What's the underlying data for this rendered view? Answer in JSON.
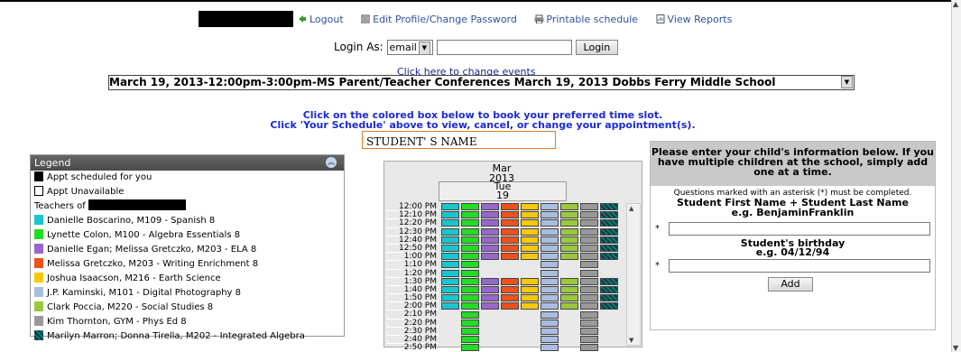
{
  "header": {
    "links": [
      {
        "label": "Logout",
        "icon": "logout-icon"
      },
      {
        "label": "Edit Profile/Change Password",
        "icon": "edit-profile-icon"
      },
      {
        "label": "Printable schedule",
        "icon": "printer-icon"
      },
      {
        "label": "View Reports",
        "icon": "reports-icon"
      }
    ]
  },
  "login": {
    "label": "Login As:",
    "select_value": "email",
    "input_value": "",
    "button": "Login"
  },
  "events": {
    "change_link": "Click here to change events",
    "selected": "March 19, 2013-12:00pm-3:00pm-MS Parent/Teacher Conferences   March 19, 2013   Dobbs Ferry Middle School"
  },
  "instructions": {
    "line1": "Click on the colored box below to book your preferred time slot.",
    "line2": "Click 'Your Schedule' above to view, cancel, or change your appointment(s)."
  },
  "student_name": "STUDENT' S NAME",
  "legend": {
    "title": "Legend",
    "appt_scheduled": "Appt scheduled for you",
    "appt_unavailable": "Appt Unavailable",
    "teachers_label": "Teachers of",
    "teachers": [
      {
        "name": "Danielle Boscarino, M109 - Spanish 8",
        "color": "#19c6cf"
      },
      {
        "name": "Lynette Colon, M100 - Algebra Essentials 8",
        "color": "#22dd22"
      },
      {
        "name": "Danielle Egan; Melissa Gretczko, M203 - ELA 8",
        "color": "#9966cc"
      },
      {
        "name": "Melissa Gretczko, M203 - Writing Enrichment 8",
        "color": "#f0501c"
      },
      {
        "name": "Joshua Isaacson, M216 - Earth Science",
        "color": "#f8c80a"
      },
      {
        "name": "J.P. Kaminski, M101 - Digital Photography 8",
        "color": "#a9bde0"
      },
      {
        "name": "Clark Poccia, M220 - Social Studies 8",
        "color": "#99c83c"
      },
      {
        "name": "Kim Thornton, GYM - Phys Ed 8",
        "color": "#999999"
      },
      {
        "name": "Marilyn Marron; Donna Tirella, M202 - Integrated Algebra",
        "color": "#0e7a78",
        "pattern": "striped"
      }
    ]
  },
  "calendar": {
    "month": "Mar",
    "year": "2013",
    "weekday": "Tue",
    "day": "19",
    "times": [
      "12:00 PM",
      "12:10 PM",
      "12:20 PM",
      "12:30 PM",
      "12:40 PM",
      "12:50 PM",
      "1:00 PM",
      "1:10 PM",
      "1:20 PM",
      "1:30 PM",
      "1:40 PM",
      "1:50 PM",
      "2:00 PM",
      "2:10 PM",
      "2:20 PM",
      "2:30 PM",
      "2:40 PM",
      "2:50 PM"
    ]
  },
  "student_form": {
    "heading": "Please enter your child's information below. If you have multiple children at the school, simply add one at a time.",
    "note": "Questions marked with an asterisk (*) must be completed.",
    "name_label": "Student First Name + Student Last Name",
    "name_example": "e.g. BenjaminFranklin",
    "birthday_label": "Student's birthday",
    "birthday_example": "e.g. 04/12/94",
    "asterisk": "*",
    "add_button": "Add"
  }
}
